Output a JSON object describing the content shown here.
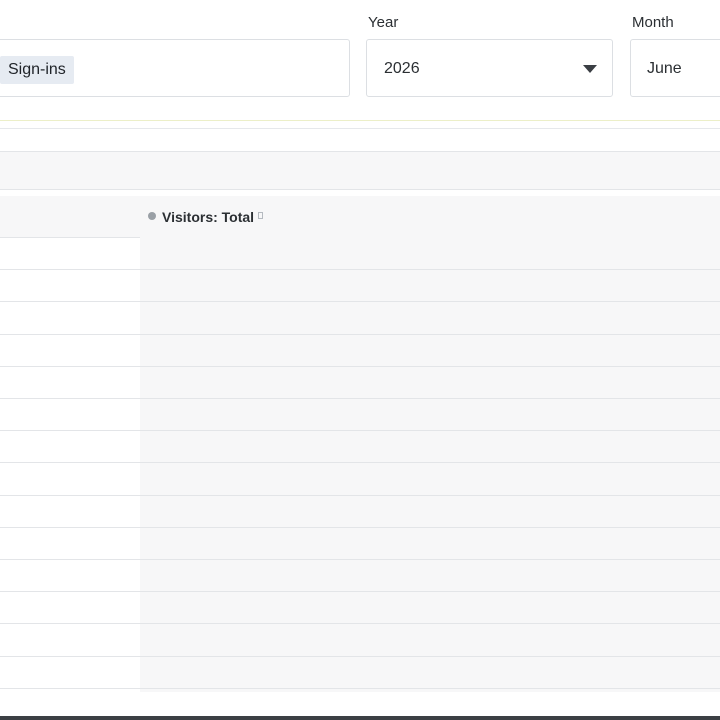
{
  "filters": {
    "metric": {
      "selected_chip": "Sign-ins"
    },
    "year": {
      "label": "Year",
      "value": "2026"
    },
    "month": {
      "label": "Month",
      "value": "June"
    }
  },
  "table": {
    "series_header": "Visitors: Total",
    "row_count": 14,
    "rows": []
  },
  "colors": {
    "chip_background": "#e6ebf2",
    "divider_accent": "#ecefc8",
    "legend_dot": "#9aa0a6",
    "band_background": "#f7f7f8"
  },
  "icons": {
    "year_dropdown": "caret-down-icon",
    "legend_marker": "dot-icon"
  }
}
